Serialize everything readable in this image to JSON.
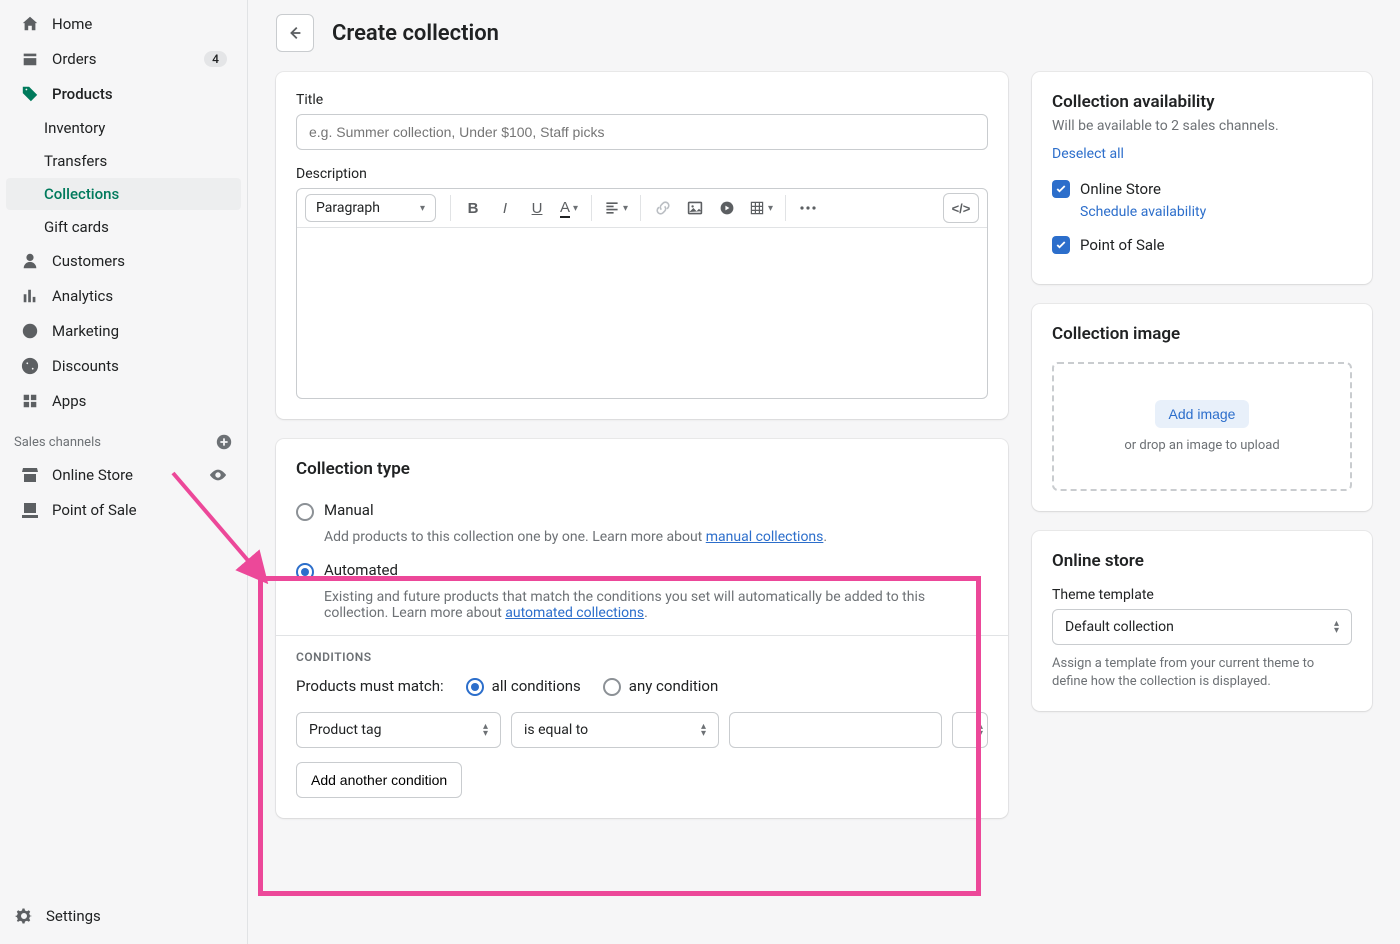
{
  "sidebar": {
    "nav": {
      "home": "Home",
      "orders": "Orders",
      "orders_badge": "4",
      "products": "Products",
      "inventory": "Inventory",
      "transfers": "Transfers",
      "collections": "Collections",
      "gift_cards": "Gift cards",
      "customers": "Customers",
      "analytics": "Analytics",
      "marketing": "Marketing",
      "discounts": "Discounts",
      "apps": "Apps"
    },
    "channels_header": "Sales channels",
    "channels": {
      "online_store": "Online Store",
      "pos": "Point of Sale"
    },
    "settings": "Settings"
  },
  "header": {
    "title": "Create collection"
  },
  "title_card": {
    "label": "Title",
    "placeholder": "e.g. Summer collection, Under $100, Staff picks",
    "desc_label": "Description",
    "para_label": "Paragraph"
  },
  "type_card": {
    "title": "Collection type",
    "manual": {
      "label": "Manual",
      "desc": "Add products to this collection one by one. Learn more about ",
      "link": "manual collections"
    },
    "automated": {
      "label": "Automated",
      "desc1": "Existing and future products that match the conditions you set will automatically be added to this collection. Learn more about ",
      "link": "automated collections"
    },
    "conditions_header": "Conditions",
    "match_label": "Products must match:",
    "match_all": "all conditions",
    "match_any": "any condition",
    "field": "Product tag",
    "operator": "is equal to",
    "add_btn": "Add another condition"
  },
  "availability": {
    "title": "Collection availability",
    "subtitle": "Will be available to 2 sales channels.",
    "deselect": "Deselect all",
    "online_store": "Online Store",
    "schedule": "Schedule availability",
    "pos": "Point of Sale"
  },
  "image_card": {
    "title": "Collection image",
    "add": "Add image",
    "hint": "or drop an image to upload"
  },
  "template_card": {
    "title": "Online store",
    "label": "Theme template",
    "value": "Default collection",
    "desc": "Assign a template from your current theme to define how the collection is displayed."
  }
}
